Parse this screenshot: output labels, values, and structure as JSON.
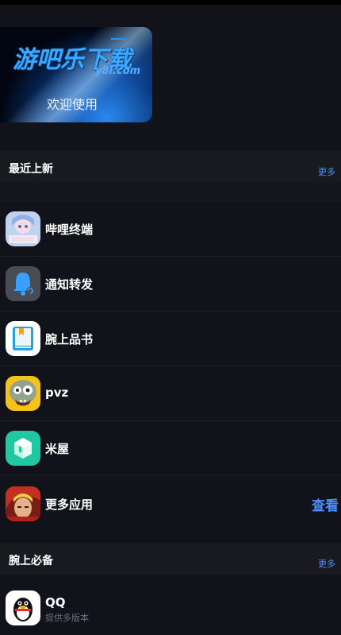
{
  "banner": {
    "logo_text": "游吧乐下载",
    "logo_sub": "y8l.com",
    "welcome": "欢迎使用"
  },
  "section_new": {
    "title": "最近上新",
    "more": "更多"
  },
  "apps_new": [
    {
      "name": "哔哩终端",
      "icon": "bilibili-anime-icon"
    },
    {
      "name": "通知转发",
      "icon": "bell-forward-icon"
    },
    {
      "name": "腕上品书",
      "icon": "book-icon"
    },
    {
      "name": "pvz",
      "icon": "zombie-icon"
    },
    {
      "name": "米屋",
      "icon": "mi-cube-icon"
    },
    {
      "name": "更多应用",
      "icon": "game-hero-icon",
      "action": "查看"
    }
  ],
  "section_essential": {
    "title": "腕上必备",
    "more": "更多"
  },
  "apps_essential": [
    {
      "name": "QQ",
      "subtitle": "提供多版本",
      "icon": "qq-penguin-icon"
    }
  ],
  "colors": {
    "background": "#12131a",
    "section_bg": "#181a20",
    "accent": "#4a8dff"
  }
}
